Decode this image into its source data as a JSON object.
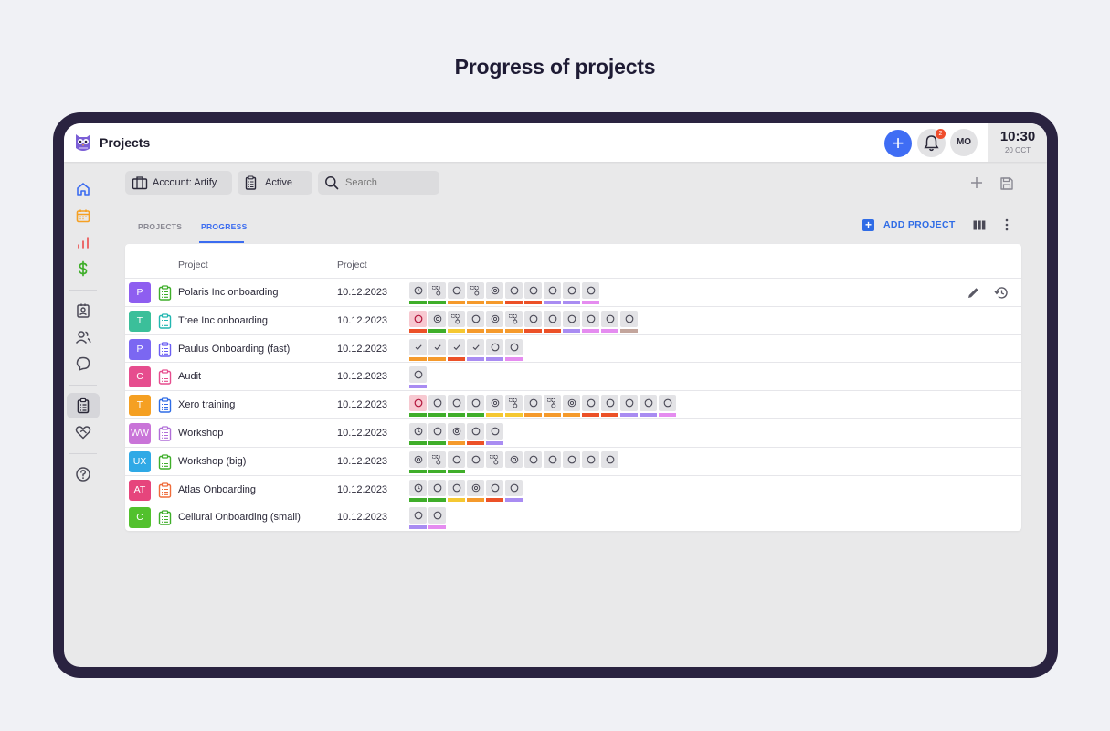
{
  "page_heading": "Progress of projects",
  "app": {
    "title": "Projects",
    "user_initials": "MO",
    "notification_count": "2",
    "clock_time": "10:30",
    "clock_date": "20 OCT"
  },
  "filters": {
    "account": "Account: Artify",
    "status": "Active",
    "search_placeholder": "Search"
  },
  "tabs": [
    "PROJECTS",
    "PROGRESS"
  ],
  "active_tab": "PROGRESS",
  "add_project_label": "ADD PROJECT",
  "table": {
    "headers": [
      "Project",
      "Project"
    ],
    "rows": [
      {
        "initials": "P",
        "avatar_color": "#8e5ef0",
        "clip_color": "#3fae2a",
        "name": "Polaris Inc onboarding",
        "date": "10.12.2023",
        "steps": [
          [
            "clock",
            "#3fae2a"
          ],
          [
            "flow",
            "#3fae2a"
          ],
          [
            "circle",
            "#f59a2c"
          ],
          [
            "flow",
            "#f59a2c"
          ],
          [
            "at",
            "#f59a2c"
          ],
          [
            "circle",
            "#ec5128"
          ],
          [
            "circle",
            "#ec5128"
          ],
          [
            "circle",
            "#a98cf2"
          ],
          [
            "circle",
            "#a98cf2"
          ],
          [
            "circle",
            "#e58cf0"
          ]
        ]
      },
      {
        "initials": "T",
        "avatar_color": "#3bbf9a",
        "clip_color": "#22b6b0",
        "name": "Tree Inc onboarding",
        "date": "10.12.2023",
        "steps": [
          [
            "circle-pink",
            "#ec5128"
          ],
          [
            "at",
            "#3fae2a"
          ],
          [
            "flow",
            "#f5c832"
          ],
          [
            "circle",
            "#f59a2c"
          ],
          [
            "at",
            "#f59a2c"
          ],
          [
            "flow",
            "#f59a2c"
          ],
          [
            "circle",
            "#ec5128"
          ],
          [
            "circle",
            "#ec5128"
          ],
          [
            "circle",
            "#a98cf2"
          ],
          [
            "circle",
            "#e58cf0"
          ],
          [
            "circle",
            "#e58cf0"
          ],
          [
            "circle",
            "#c3a59c"
          ]
        ]
      },
      {
        "initials": "P",
        "avatar_color": "#7b67f2",
        "clip_color": "#6a5ef2",
        "name": "Paulus Onboarding (fast)",
        "date": "10.12.2023",
        "steps": [
          [
            "check",
            "#f59a2c"
          ],
          [
            "check",
            "#f59a2c"
          ],
          [
            "check",
            "#ec5128"
          ],
          [
            "check",
            "#a98cf2"
          ],
          [
            "circle",
            "#a98cf2"
          ],
          [
            "circle",
            "#e58cf0"
          ]
        ]
      },
      {
        "initials": "C",
        "avatar_color": "#e64d8e",
        "clip_color": "#e64d8e",
        "name": "Audit",
        "date": "10.12.2023",
        "steps": [
          [
            "circle",
            "#a98cf2"
          ]
        ]
      },
      {
        "initials": "T",
        "avatar_color": "#f5a023",
        "clip_color": "#2f6ce6",
        "name": "Xero training",
        "date": "10.12.2023",
        "steps": [
          [
            "circle-pink",
            "#3fae2a"
          ],
          [
            "circle",
            "#3fae2a"
          ],
          [
            "circle",
            "#3fae2a"
          ],
          [
            "circle",
            "#3fae2a"
          ],
          [
            "at",
            "#f5c832"
          ],
          [
            "flow",
            "#f5c832"
          ],
          [
            "circle",
            "#f59a2c"
          ],
          [
            "flow",
            "#f59a2c"
          ],
          [
            "at",
            "#f59a2c"
          ],
          [
            "circle",
            "#ec5128"
          ],
          [
            "circle",
            "#ec5128"
          ],
          [
            "circle",
            "#a98cf2"
          ],
          [
            "circle",
            "#a98cf2"
          ],
          [
            "circle",
            "#e58cf0"
          ]
        ]
      },
      {
        "initials": "WW",
        "avatar_color": "#c974d8",
        "clip_color": "#b06ed8",
        "name": "Workshop",
        "date": "10.12.2023",
        "steps": [
          [
            "clock",
            "#3fae2a"
          ],
          [
            "circle",
            "#3fae2a"
          ],
          [
            "at",
            "#f59a2c"
          ],
          [
            "circle",
            "#ec5128"
          ],
          [
            "circle",
            "#a98cf2"
          ]
        ]
      },
      {
        "initials": "UX",
        "avatar_color": "#2fa9e6",
        "clip_color": "#3fae2a",
        "name": "Workshop (big)",
        "date": "10.12.2023",
        "steps": [
          [
            "at",
            "#3fae2a"
          ],
          [
            "flow",
            "#3fae2a"
          ],
          [
            "circle",
            "#3fae2a"
          ],
          [
            "circle",
            ""
          ],
          [
            "flow",
            ""
          ],
          [
            "at",
            ""
          ],
          [
            "circle",
            ""
          ],
          [
            "circle",
            ""
          ],
          [
            "circle",
            ""
          ],
          [
            "circle",
            ""
          ],
          [
            "circle",
            ""
          ]
        ]
      },
      {
        "initials": "AT",
        "avatar_color": "#e6457c",
        "clip_color": "#ef6b3a",
        "name": "Atlas Onboarding",
        "date": "10.12.2023",
        "steps": [
          [
            "clock",
            "#3fae2a"
          ],
          [
            "circle",
            "#3fae2a"
          ],
          [
            "circle",
            "#f5c832"
          ],
          [
            "at",
            "#f59a2c"
          ],
          [
            "circle",
            "#ec5128"
          ],
          [
            "circle",
            "#a98cf2"
          ]
        ]
      },
      {
        "initials": "C",
        "avatar_color": "#52c12d",
        "clip_color": "#3fae2a",
        "name": "Cellural Onboarding (small)",
        "date": "10.12.2023",
        "steps": [
          [
            "circle",
            "#a98cf2"
          ],
          [
            "circle",
            "#e58cf0"
          ]
        ]
      }
    ]
  }
}
